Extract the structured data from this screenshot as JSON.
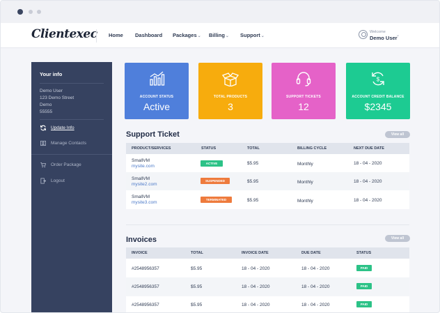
{
  "brand": {
    "logo": "Clientexec"
  },
  "nav": [
    {
      "label": "Home",
      "dropdown": false
    },
    {
      "label": "Dashboard",
      "dropdown": false
    },
    {
      "label": "Packages",
      "dropdown": true
    },
    {
      "label": "Billing",
      "dropdown": true
    },
    {
      "label": "Support",
      "dropdown": true
    }
  ],
  "user": {
    "welcome": "Welcome",
    "name": "Demo User"
  },
  "sidebar": {
    "title": "Your info",
    "address": [
      "Demo User",
      "123 Demo Street",
      "Demo",
      "55555"
    ],
    "items": [
      {
        "label": "Update Info",
        "icon": "refresh-icon",
        "active": true
      },
      {
        "label": "Manage Contacts",
        "icon": "contacts-icon",
        "active": false
      },
      {
        "label": "Order Package",
        "icon": "cart-icon",
        "active": false
      },
      {
        "label": "Logout",
        "icon": "logout-icon",
        "active": false
      }
    ]
  },
  "stats": [
    {
      "label": "ACCOUNT STATUS",
      "value": "Active",
      "color": "#4f7fdb",
      "icon": "chart-icon"
    },
    {
      "label": "TOTAL PRODUCTS",
      "value": "3",
      "color": "#f7ac0d",
      "icon": "box-icon"
    },
    {
      "label": "SUPPORT TICKETS",
      "value": "12",
      "color": "#e562c8",
      "icon": "headset-icon"
    },
    {
      "label": "ACCOUNT CREDIT BALANCE",
      "value": "$2345",
      "color": "#1dcb92",
      "icon": "dollar-cycle-icon"
    }
  ],
  "support": {
    "title": "Support Ticket",
    "view_all": "View all",
    "headers": [
      "PRODUCT/SERVICES",
      "STATUS",
      "TOTAL",
      "BILLING CYCLE",
      "NEXT DUE DATE"
    ],
    "rows": [
      {
        "product": "SmallVM",
        "site": "mysite.com",
        "status": "ACTIVE",
        "status_color": "#2cc287",
        "total": "$5.95",
        "cycle": "Monthly",
        "due": "18 - 04 - 2020"
      },
      {
        "product": "SmallVM",
        "site": "mysite2.com",
        "status": "SUSPENDED",
        "status_color": "#ee7b3d",
        "total": "$5.95",
        "cycle": "Monthly",
        "due": "18 - 04 - 2020"
      },
      {
        "product": "SmallVM",
        "site": "mysite3.com",
        "status": "TERMINATED",
        "status_color": "#ee7b3d",
        "total": "$5.95",
        "cycle": "Monthly",
        "due": "18 - 04 - 2020"
      }
    ]
  },
  "invoices": {
    "title": "Invoices",
    "view_all": "View all",
    "headers": [
      "INVOICE",
      "TOTAL",
      "INVOICE DATE",
      "DUE DATE",
      "STATUS"
    ],
    "rows": [
      {
        "invoice": "#2548956357",
        "total": "$5.95",
        "date": "18 - 04 - 2020",
        "due": "18 - 04 - 2020",
        "status": "PAID"
      },
      {
        "invoice": "#2548956357",
        "total": "$5.95",
        "date": "18 - 04 - 2020",
        "due": "18 - 04 - 2020",
        "status": "PAID"
      },
      {
        "invoice": "#2548956357",
        "total": "$5.95",
        "date": "18 - 04 - 2020",
        "due": "18 - 04 - 2020",
        "status": "PAID"
      }
    ],
    "paid_color": "#2cc287"
  }
}
